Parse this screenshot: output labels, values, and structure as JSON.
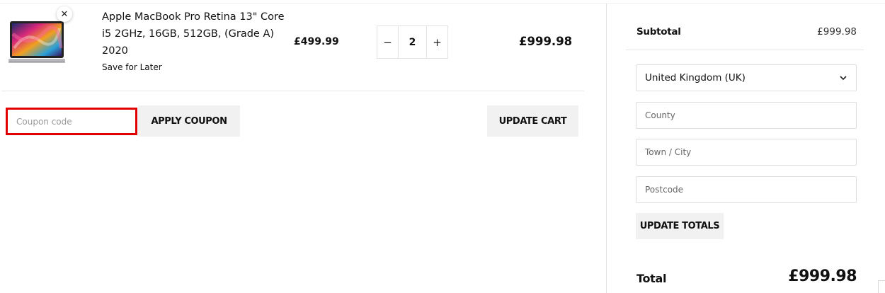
{
  "cart_item": {
    "remove_icon": "close-icon",
    "name": "Apple MacBook Pro Retina 13\" Core i5 2GHz, 16GB, 512GB, (Grade A) 2020",
    "save_for_later": "Save for Later",
    "price": "£499.99",
    "quantity": "2",
    "minus_label": "−",
    "plus_label": "+",
    "line_total": "£999.98"
  },
  "coupon": {
    "placeholder": "Coupon code",
    "value": "",
    "apply_label": "APPLY COUPON"
  },
  "update_cart_label": "UPDATE CART",
  "totals": {
    "subtotal_label": "Subtotal",
    "subtotal_value": "£999.98",
    "country": "United Kingdom (UK)",
    "county_placeholder": "County",
    "town_placeholder": "Town / City",
    "postcode_placeholder": "Postcode",
    "update_totals_label": "UPDATE TOTALS",
    "total_label": "Total",
    "total_value": "£999.98"
  },
  "colors": {
    "highlight_border": "#e00000",
    "button_bg": "#f1f1f1"
  }
}
